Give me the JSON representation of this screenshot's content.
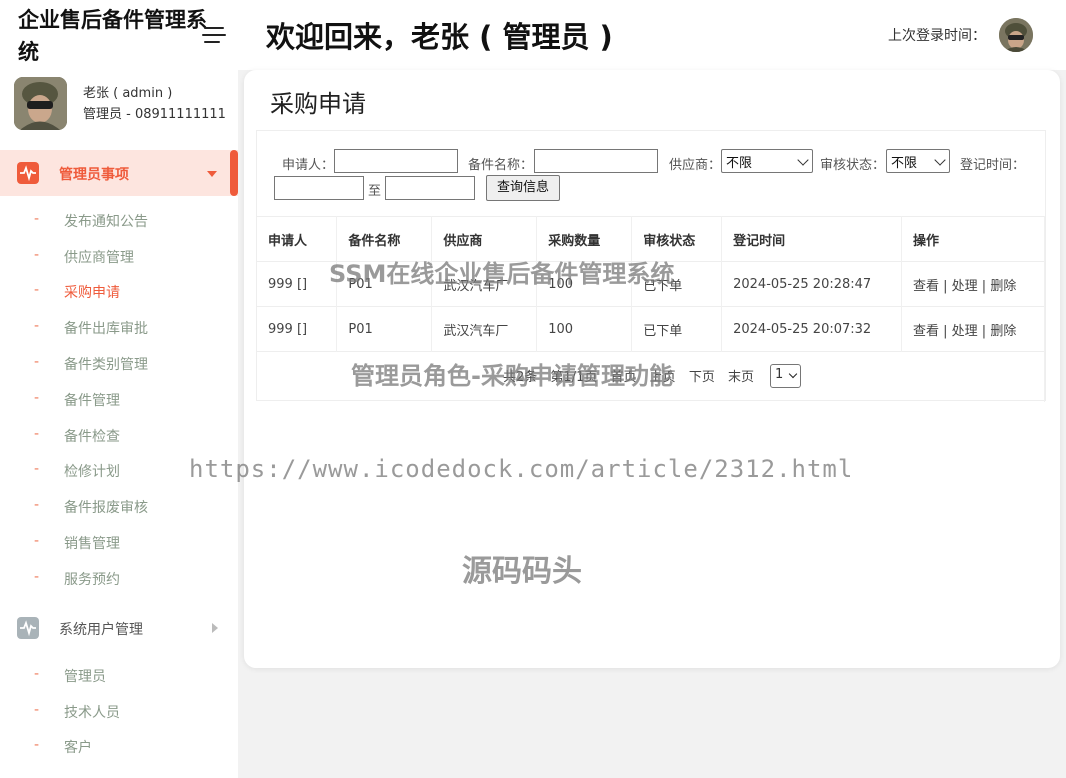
{
  "app": {
    "title": "企业售后备件管理系统",
    "welcome": "欢迎回来，老张 ( 管理员 )",
    "last_login_label": "上次登录时间："
  },
  "user": {
    "name_line": "老张 ( admin )",
    "role_line": "管理员 - 08911111111"
  },
  "sidebar": {
    "groups": [
      {
        "label": "管理员事项",
        "icon": "pulse-icon",
        "expanded": true,
        "items": [
          "发布通知公告",
          "供应商管理",
          "采购申请",
          "备件出库审批",
          "备件类别管理",
          "备件管理",
          "备件检查",
          "检修计划",
          "备件报废审核",
          "销售管理",
          "服务预约"
        ]
      },
      {
        "label": "系统用户管理",
        "icon": "pulse-icon",
        "expanded": true,
        "items": [
          "管理员",
          "技术人员",
          "客户"
        ]
      }
    ],
    "active_item": "采购申请"
  },
  "page": {
    "title": "采购申请"
  },
  "filters": {
    "applicant_label": "申请人：",
    "applicant_value": "",
    "part_name_label": "备件名称：",
    "part_name_value": "",
    "supplier_label": "供应商：",
    "supplier_value": "不限",
    "status_label": "审核状态：",
    "status_value": "不限",
    "date_label": "登记时间：",
    "date_from": "",
    "date_sep": "至",
    "date_to": "",
    "query_button": "查询信息"
  },
  "table": {
    "headers": [
      "申请人",
      "备件名称",
      "供应商",
      "采购数量",
      "审核状态",
      "登记时间",
      "操作"
    ],
    "rows": [
      {
        "applicant": "999 []",
        "part": "P01",
        "supplier": "武汉汽车厂",
        "qty": "100",
        "status": "已下单",
        "time": "2024-05-25 20:28:47",
        "ops": "查看 | 处理 | 删除"
      },
      {
        "applicant": "999 []",
        "part": "P01",
        "supplier": "武汉汽车厂",
        "qty": "100",
        "status": "已下单",
        "time": "2024-05-25 20:07:32",
        "ops": "查看 | 处理 | 删除"
      }
    ]
  },
  "pager": {
    "total": "共2条",
    "page_of": "第1/1页",
    "first": "首页",
    "prev": "上页",
    "next": "下页",
    "last": "末页",
    "current": "1"
  },
  "watermarks": {
    "line1": "SSM在线企业售后备件管理系统",
    "line2": "管理员角色-采购申请管理功能",
    "url": "https://www.icodedock.com/article/2312.html",
    "brand": "源码码头"
  },
  "colors": {
    "accent": "#ef5b3b",
    "accent_bg": "#fde5df",
    "sub_item_text": "#8a9a8a"
  }
}
